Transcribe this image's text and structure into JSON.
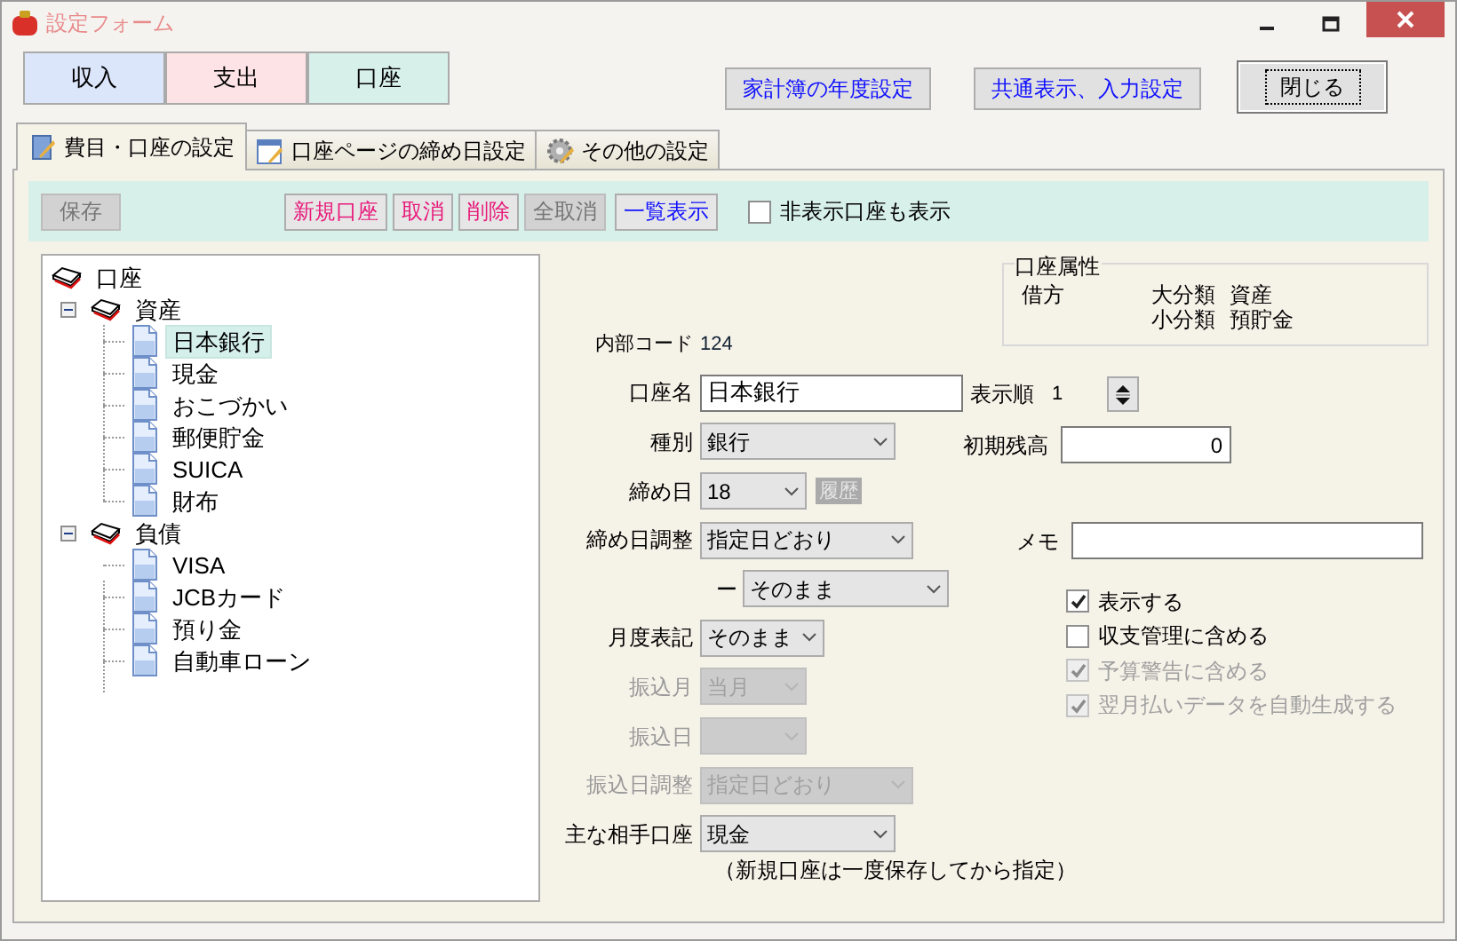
{
  "window": {
    "title": "設定フォーム"
  },
  "category_tabs": [
    {
      "label": "収入",
      "color": "#dbe6fb"
    },
    {
      "label": "支出",
      "color": "#fde3e5"
    },
    {
      "label": "口座",
      "color": "#d8f0ea"
    }
  ],
  "top_buttons": [
    {
      "label": "家計簿の年度設定",
      "kind": "link",
      "focused": false
    },
    {
      "label": "共通表示、入力設定",
      "kind": "link",
      "focused": false
    },
    {
      "label": "閉じる",
      "kind": "plain",
      "focused": true
    }
  ],
  "tabs": [
    {
      "label": "費目・口座の設定",
      "selected": true
    },
    {
      "label": "口座ページの締め日設定",
      "selected": false
    },
    {
      "label": "その他の設定",
      "selected": false
    }
  ],
  "toolbar": {
    "buttons": [
      {
        "label": "保存",
        "disabled": true
      },
      {
        "label": "新規口座",
        "kind": "action",
        "disabled": false
      },
      {
        "label": "取消",
        "kind": "action",
        "disabled": false
      },
      {
        "label": "削除",
        "kind": "action",
        "disabled": false
      },
      {
        "label": "全取消",
        "disabled": true
      },
      {
        "label": "一覧表示",
        "kind": "view",
        "disabled": false
      }
    ],
    "checkbox": {
      "label": "非表示口座も表示",
      "checked": false
    }
  },
  "tree": {
    "label": "口座",
    "selected": false,
    "children": [
      {
        "label": "資産",
        "selected": false,
        "expanded": true,
        "children": [
          {
            "label": "日本銀行",
            "selected": true
          },
          {
            "label": "現金",
            "selected": false
          },
          {
            "label": "おこづかい",
            "selected": false
          },
          {
            "label": "郵便貯金",
            "selected": false
          },
          {
            "label": "SUICA",
            "selected": false
          },
          {
            "label": "財布",
            "selected": false
          }
        ]
      },
      {
        "label": "負債",
        "selected": false,
        "expanded": true,
        "children": [
          {
            "label": "VISA",
            "selected": false
          },
          {
            "label": "JCBカード",
            "selected": false
          },
          {
            "label": "預り金",
            "selected": false
          },
          {
            "label": "自動車ローン",
            "selected": false
          }
        ]
      }
    ]
  },
  "form": [
    {
      "kind": "readonly",
      "label": "内部コード",
      "value": "124"
    },
    {
      "kind": "text",
      "label": "口座名",
      "value": "日本銀行"
    },
    {
      "kind": "select",
      "label": "種別",
      "value": "銀行",
      "disabled": false
    },
    {
      "kind": "select",
      "label": "締め日",
      "value": "18",
      "disabled": false,
      "extra_button": {
        "label": "履歴",
        "disabled": true
      }
    },
    {
      "kind": "select",
      "label": "締め日調整",
      "value": "指定日どおり",
      "disabled": false
    },
    {
      "kind": "select",
      "label": "ー",
      "value": "そのまま",
      "disabled": false
    },
    {
      "kind": "select",
      "label": "月度表記",
      "value": "そのまま",
      "disabled": false
    },
    {
      "kind": "select",
      "label": "振込月",
      "value": "当月",
      "disabled": true
    },
    {
      "kind": "select",
      "label": "振込日",
      "disabled": true
    },
    {
      "kind": "select",
      "label": "振込日調整",
      "value": "指定日どおり",
      "disabled": true
    },
    {
      "kind": "select",
      "label": "主な相手口座",
      "value": "現金",
      "disabled": false
    }
  ],
  "form_note": "（新規口座は一度保存してから指定）",
  "attributes": {
    "title": "口座属性",
    "side": "借方",
    "rows": [
      {
        "label": "大分類",
        "value": "資産"
      },
      {
        "label": "小分類",
        "value": "預貯金"
      }
    ]
  },
  "display_order": {
    "label": "表示順",
    "value": "1"
  },
  "initial_balance": {
    "label": "初期残高",
    "value": "0"
  },
  "memo": {
    "label": "メモ"
  },
  "checkboxes": [
    {
      "label": "表示する",
      "checked": true,
      "disabled": false
    },
    {
      "label": "収支管理に含める",
      "checked": false,
      "disabled": false
    },
    {
      "label": "予算警告に含める",
      "checked": true,
      "disabled": true
    },
    {
      "label": "翌月払いデータを自動生成する",
      "checked": true,
      "disabled": true
    }
  ]
}
